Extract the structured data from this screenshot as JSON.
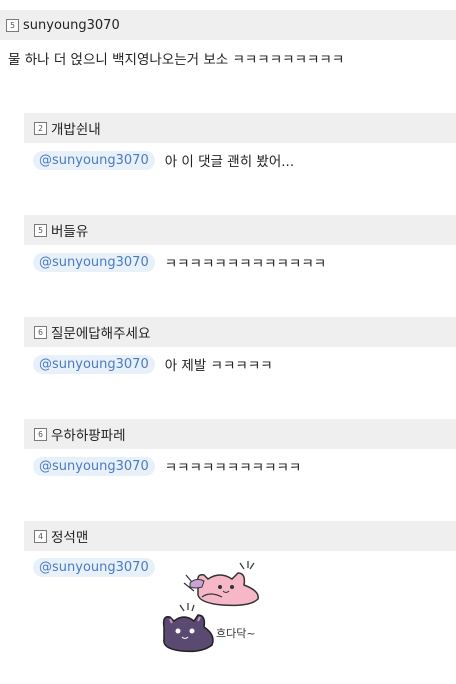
{
  "root_comment": {
    "level": "5",
    "username": "sunyoung3070",
    "text": "물 하나 더 얹으니 백지영나오는거 보소 ㅋㅋㅋㅋㅋㅋㅋㅋㅋ"
  },
  "replies": [
    {
      "level": "2",
      "username": "개밥쉰내",
      "mention": "@sunyoung3070",
      "text": "아 이 댓글 괜히 봤어..."
    },
    {
      "level": "5",
      "username": "버들유",
      "mention": "@sunyoung3070",
      "text": "ㅋㅋㅋㅋㅋㅋㅋㅋㅋㅋㅋㅋㅋ"
    },
    {
      "level": "6",
      "username": "질문에답해주세요",
      "mention": "@sunyoung3070",
      "text": "아 제발 ㅋㅋㅋㅋㅋ"
    },
    {
      "level": "6",
      "username": "우하하팡파레",
      "mention": "@sunyoung3070",
      "text": "ㅋㅋㅋㅋㅋㅋㅋㅋㅋㅋㅋ"
    },
    {
      "level": "4",
      "username": "정석맨",
      "mention": "@sunyoung3070",
      "text": ""
    }
  ],
  "sticker": {
    "name": "cat-stickers",
    "caption": "흐다닥~"
  },
  "colors": {
    "bar_bg": "#efefef",
    "mention_bg": "#e8f0fa",
    "mention_text": "#4a7cc0"
  }
}
